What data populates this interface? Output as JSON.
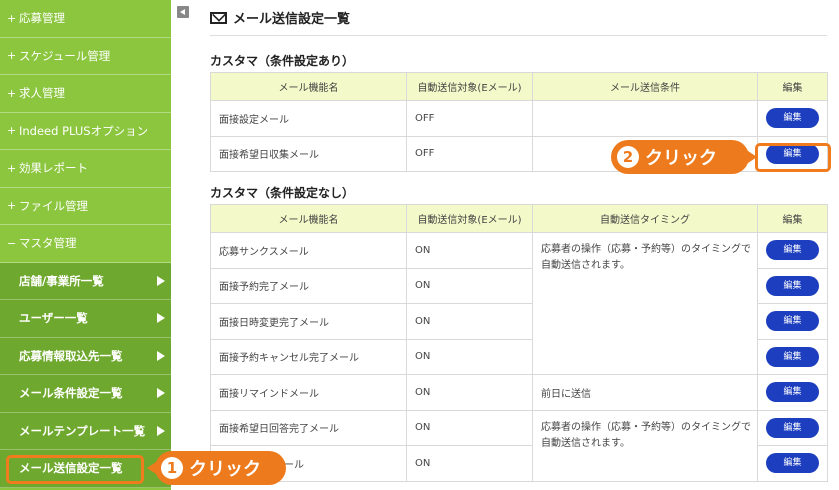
{
  "sidebar": {
    "items": [
      {
        "prefix": "+",
        "label": "応募管理"
      },
      {
        "prefix": "+",
        "label": "スケジュール管理"
      },
      {
        "prefix": "+",
        "label": "求人管理"
      },
      {
        "prefix": "+",
        "label": "Indeed PLUSオプション"
      },
      {
        "prefix": "+",
        "label": "効果レポート"
      },
      {
        "prefix": "+",
        "label": "ファイル管理"
      },
      {
        "prefix": "−",
        "label": "マスタ管理"
      }
    ],
    "sub_items": [
      {
        "label": "店舗/事業所一覧"
      },
      {
        "label": "ユーザー一覧"
      },
      {
        "label": "応募情報取込先一覧"
      },
      {
        "label": "メール条件設定一覧"
      },
      {
        "label": "メールテンプレート一覧"
      },
      {
        "label": "メール送信設定一覧"
      }
    ]
  },
  "header": {
    "title": "メール送信設定一覧"
  },
  "section1": {
    "title": "カスタマ（条件設定あり）",
    "columns": [
      "メール機能名",
      "自動送信対象(Eメール)",
      "メール送信条件",
      "編集"
    ],
    "rows": [
      {
        "name": "面接設定メール",
        "target": "OFF",
        "condition": "",
        "edit": "編集"
      },
      {
        "name": "面接希望日収集メール",
        "target": "OFF",
        "condition": "",
        "edit": "編集"
      }
    ]
  },
  "section2": {
    "title": "カスタマ（条件設定なし）",
    "columns": [
      "メール機能名",
      "自動送信対象(Eメール)",
      "自動送信タイミング",
      "編集"
    ],
    "rows": [
      {
        "name": "応募サンクスメール",
        "target": "ON",
        "edit": "編集"
      },
      {
        "name": "面接予約完了メール",
        "target": "ON",
        "edit": "編集"
      },
      {
        "name": "面接日時変更完了メール",
        "target": "ON",
        "edit": "編集"
      },
      {
        "name": "面接予約キャンセル完了メール",
        "target": "ON",
        "edit": "編集"
      },
      {
        "name": "面接リマインドメール",
        "target": "ON",
        "edit": "編集"
      },
      {
        "name": "面接希望日回答完了メール",
        "target": "ON",
        "edit": "編集"
      },
      {
        "name": "ール",
        "target": "ON",
        "edit": "編集"
      }
    ],
    "timing_group1": "応募者の操作（応募・予約等）のタイミングで自動送信されます。",
    "timing_reminder": "前日に送信",
    "timing_group2": "応募者の操作（応募・予約等）のタイミングで自動送信されます。"
  },
  "callouts": {
    "step1": {
      "num": "1",
      "text": "クリック"
    },
    "step2": {
      "num": "2",
      "text": "クリック"
    }
  },
  "colors": {
    "sidebar_bg": "#8cc63f",
    "sidebar_sub_bg": "#6fa82e",
    "accent_orange": "#ed7a1c",
    "edit_button": "#1d3fbf",
    "table_header_bg": "#f3f9c8"
  }
}
